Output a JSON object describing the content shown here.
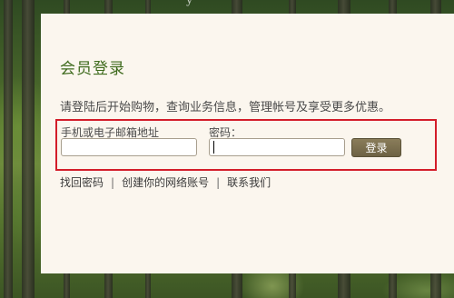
{
  "header": {
    "logo_fragment": "y"
  },
  "login": {
    "title": "会员登录",
    "intro": "请登陆后开始购物，查询业务信息，管理帐号及享受更多优惠。",
    "account_label": "手机或电子邮箱地址",
    "account_value": "",
    "password_label": "密码：",
    "password_value": "",
    "submit_label": "登录"
  },
  "links": {
    "forgot_password": "找回密码",
    "create_account": "创建你的网络账号",
    "contact_us": "联系我们",
    "separator": "|"
  },
  "colors": {
    "title": "#3f6b1e",
    "highlight_border": "#d31d2a",
    "button": "#7c7050",
    "panel": "#fbf6ee"
  }
}
